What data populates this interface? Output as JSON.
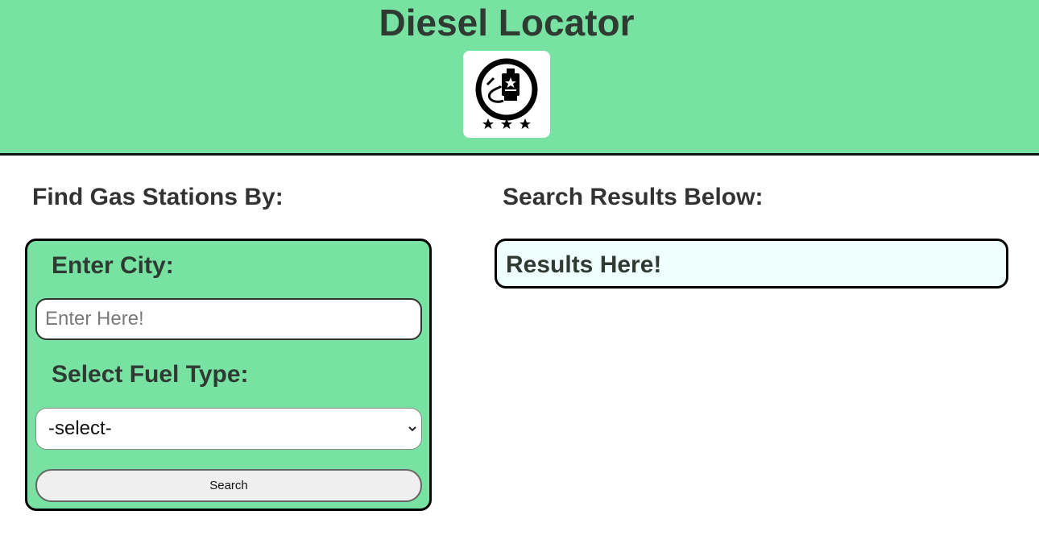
{
  "header": {
    "title": "Diesel Locator",
    "logo_icon": "fuel-can-badge-icon",
    "background_color": "#78e2a2"
  },
  "search_section": {
    "heading": "Find Gas Stations By:",
    "city_label": "Enter City:",
    "city_placeholder": "Enter Here!",
    "city_value": "",
    "fuel_label": "Select Fuel Type:",
    "fuel_selected": "-select-",
    "search_button_label": "Search"
  },
  "results_section": {
    "heading": "Search Results Below:",
    "placeholder_text": "Results Here!",
    "background_color": "#eefffe"
  }
}
